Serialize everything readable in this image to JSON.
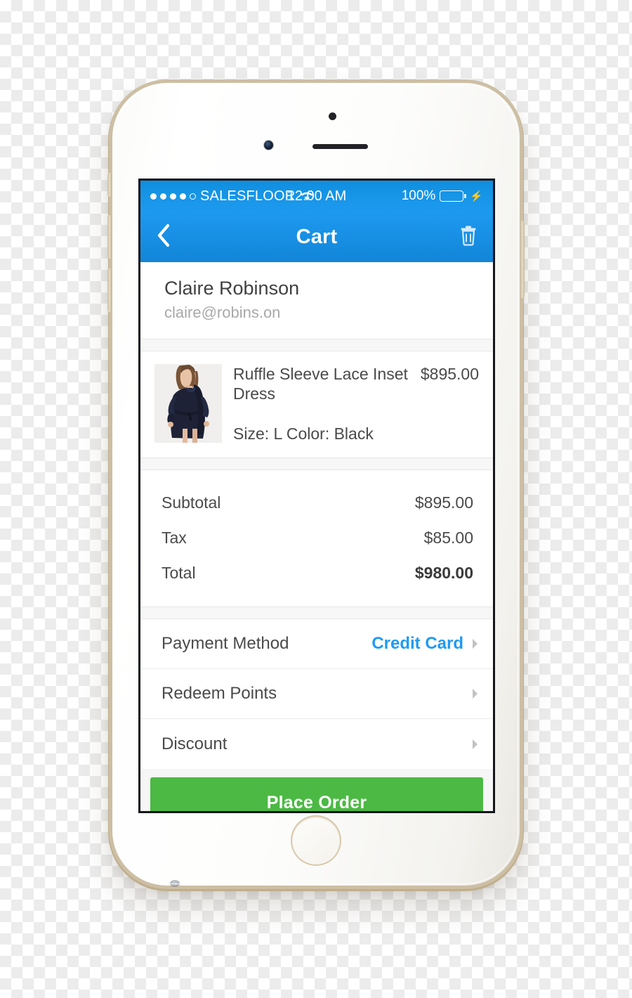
{
  "status_bar": {
    "signal_dots_filled": 4,
    "signal_dots_total": 5,
    "carrier": "SALESFLOOR",
    "wifi_icon": "wifi-icon",
    "time": "12:00 AM",
    "battery_percent": "100%",
    "battery_level": 100,
    "charging_icon": "⚡",
    "bar_color": "#1896e8"
  },
  "nav_bar": {
    "back_icon": "chevron-left-icon",
    "title": "Cart",
    "delete_icon": "trash-icon",
    "bar_color": "#1b95ec"
  },
  "customer": {
    "name": "Claire Robinson",
    "email": "claire@robins.on"
  },
  "product": {
    "image_alt": "model-wearing-navy-dress",
    "name": "Ruffle Sleeve Lace Inset Dress",
    "price": "$895.00",
    "variant": "Size: L  Color: Black"
  },
  "totals": [
    {
      "label": "Subtotal",
      "amount": "$895.00",
      "emphasis": false
    },
    {
      "label": "Tax",
      "amount": "$85.00",
      "emphasis": false
    },
    {
      "label": "Total",
      "amount": "$980.00",
      "emphasis": true
    }
  ],
  "options": [
    {
      "label": "Payment Method",
      "value": "Credit Card",
      "chevron": "chevron-right-icon"
    },
    {
      "label": "Redeem Points",
      "value": "",
      "chevron": "chevron-right-icon"
    },
    {
      "label": "Discount",
      "value": "",
      "chevron": "chevron-right-icon"
    }
  ],
  "cta": {
    "label": "Place Order",
    "color": "#4cb944"
  },
  "theme": {
    "accent_blue": "#1e9bf5",
    "cta_green": "#4cb944",
    "text_dark": "#4a4a4a",
    "text_muted": "#a9a9a9"
  }
}
